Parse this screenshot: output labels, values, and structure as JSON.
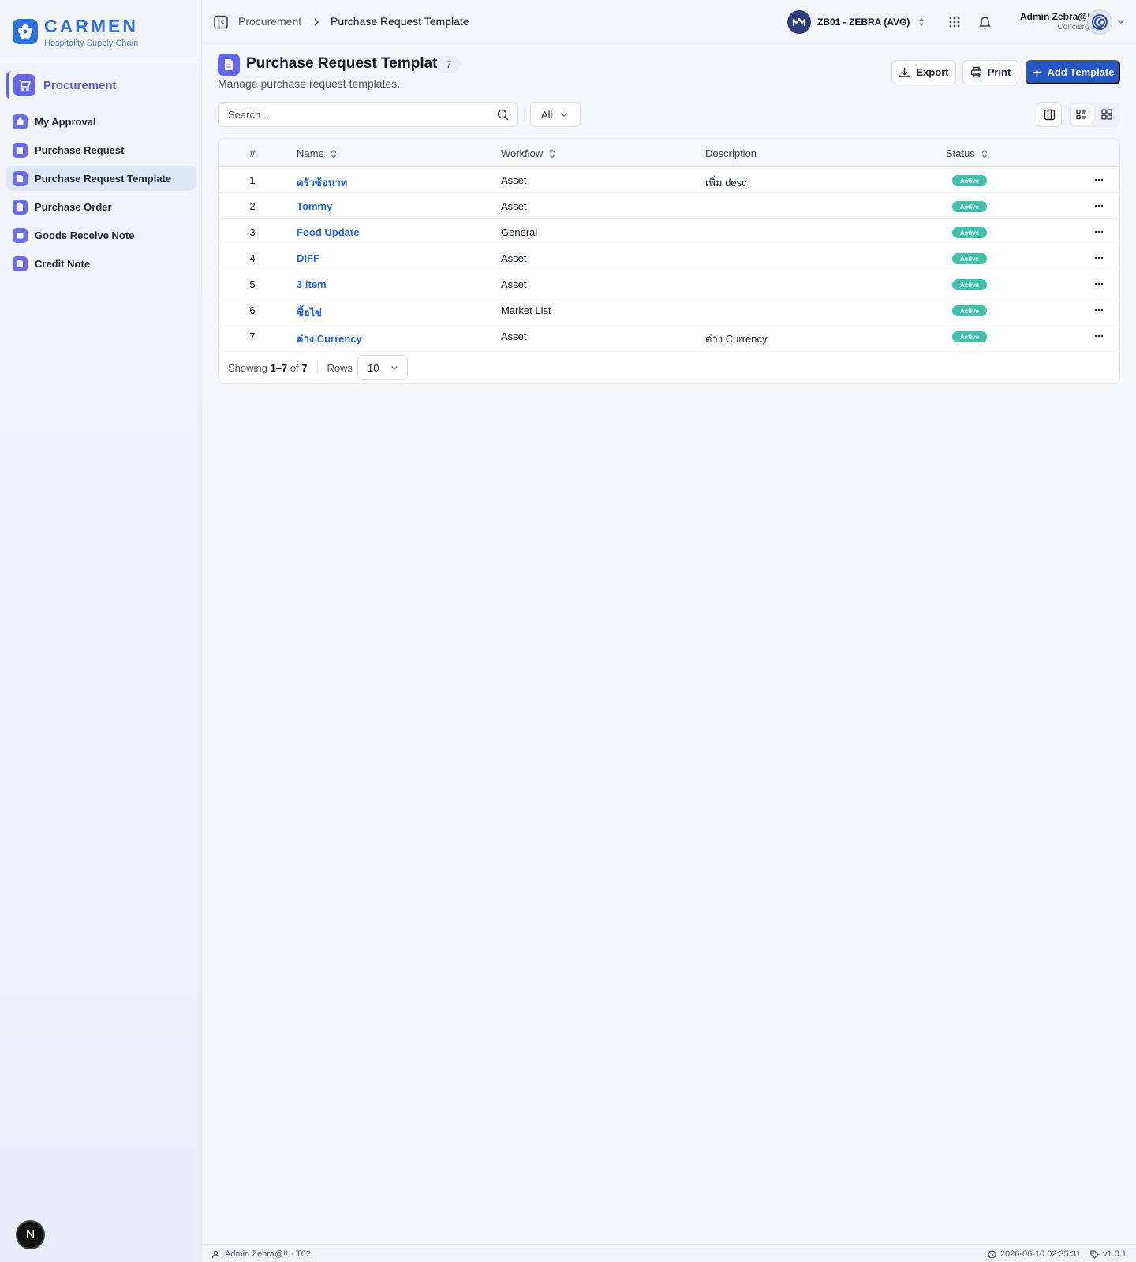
{
  "brand": {
    "name": "CARMEN",
    "subtitle": "Hospitality Supply Chain"
  },
  "sidebar": {
    "module": "Procurement",
    "items": [
      {
        "label": "My Approval",
        "active": false
      },
      {
        "label": "Purchase Request",
        "active": false
      },
      {
        "label": "Purchase Request Template",
        "active": true
      },
      {
        "label": "Purchase Order",
        "active": false
      },
      {
        "label": "Goods Receive Note",
        "active": false
      },
      {
        "label": "Credit Note",
        "active": false
      }
    ],
    "bottom_badge": "N"
  },
  "topbar": {
    "breadcrumb": [
      "Procurement",
      "Purchase Request Template"
    ],
    "business_unit": "ZB01 - ZEBRA (AVG)",
    "user": {
      "name": "Admin Zebra@!!",
      "role": "Concierge"
    }
  },
  "page": {
    "title": "Purchase Request Template",
    "count": "7",
    "subtitle": "Manage purchase request templates.",
    "buttons": {
      "export": "Export",
      "print": "Print",
      "add": "Add Template"
    },
    "search_placeholder": "Search...",
    "filter_value": "All"
  },
  "table": {
    "headers": {
      "num": "#",
      "name": "Name",
      "workflow": "Workflow",
      "description": "Description",
      "status": "Status"
    },
    "rows": [
      {
        "num": "1",
        "name": "ครัวซ้อนาท",
        "workflow": "Asset",
        "description": "เพิ่ม desc",
        "status": "Active"
      },
      {
        "num": "2",
        "name": "Tommy",
        "workflow": "Asset",
        "description": "",
        "status": "Active"
      },
      {
        "num": "3",
        "name": "Food Update",
        "workflow": "General",
        "description": "",
        "status": "Active"
      },
      {
        "num": "4",
        "name": "DIFF",
        "workflow": "Asset",
        "description": "",
        "status": "Active"
      },
      {
        "num": "5",
        "name": "3 item",
        "workflow": "Asset",
        "description": "",
        "status": "Active"
      },
      {
        "num": "6",
        "name": "ซื้อไข่",
        "workflow": "Market List",
        "description": "",
        "status": "Active"
      },
      {
        "num": "7",
        "name": "ต่าง Currency",
        "workflow": "Asset",
        "description": "ต่าง Currency",
        "status": "Active"
      }
    ],
    "footer": {
      "showing_label": "Showing",
      "range": "1–7",
      "of_label": "of",
      "total": "7",
      "rows_label": "Rows",
      "rows_value": "10"
    }
  },
  "status_bar": {
    "user": "Admin Zebra@!!",
    "sep": "·",
    "tenant": "T02",
    "datetime": "2026-06-10 02:35:31",
    "version": "v1.0.1"
  },
  "colors": {
    "primary": "#2456c5",
    "accent": "#6366f1",
    "link": "#2563eb",
    "status_active": "#3fc1ac"
  }
}
